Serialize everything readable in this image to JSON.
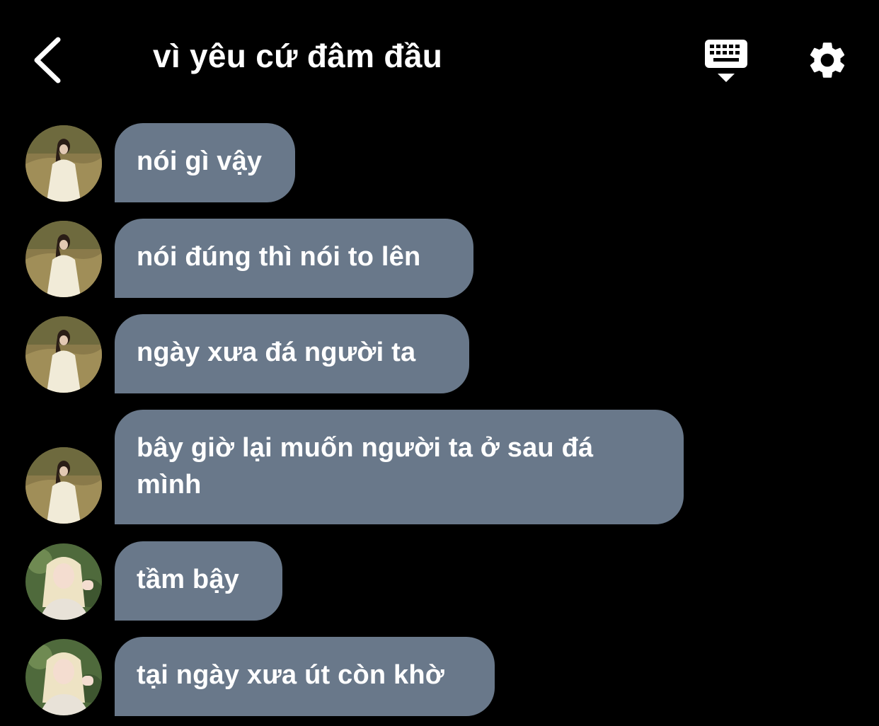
{
  "header": {
    "title": "vì yêu cứ đâm đầu",
    "back_icon": "chevron-left-icon",
    "keyboard_icon": "keyboard-icon",
    "settings_icon": "gear-icon"
  },
  "colors": {
    "background": "#000000",
    "bubble": "#69788a",
    "text": "#ffffff"
  },
  "messages": [
    {
      "sender": "a",
      "text": "nói gì vậy"
    },
    {
      "sender": "a",
      "text": "nói đúng thì nói to lên"
    },
    {
      "sender": "a",
      "text": "ngày xưa đá người ta"
    },
    {
      "sender": "a",
      "text": "bây giờ lại muốn người ta ở sau đá mình"
    },
    {
      "sender": "b",
      "text": "tầm bậy"
    },
    {
      "sender": "b",
      "text": "tại ngày xưa út còn khờ"
    }
  ]
}
